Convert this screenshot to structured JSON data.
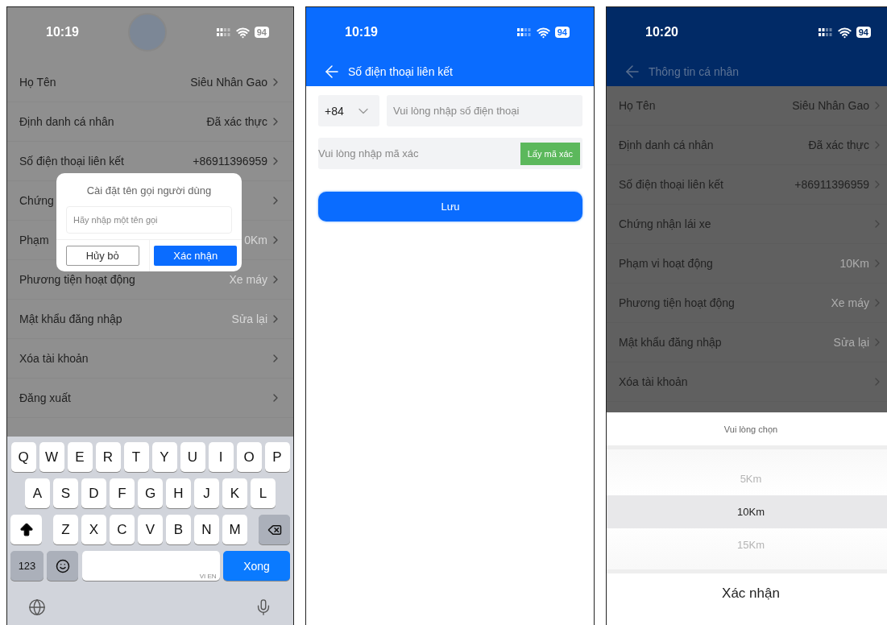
{
  "profile_dialog_screen": {
    "status_bar": {
      "time": "10:19",
      "battery": "94"
    },
    "rows": [
      {
        "label": "Họ Tên",
        "value": "Siêu Nhân Gao",
        "muted": false
      },
      {
        "label": "Định danh cá nhân",
        "value": "Đã xác thực",
        "muted": false
      },
      {
        "label": "Số điện thoại liên kết",
        "value": "+86911396959",
        "muted": false
      },
      {
        "label": "Chứng"
      },
      {
        "label": "Phạm",
        "value": "0Km",
        "muted": true
      },
      {
        "label": "Phương tiện hoạt động",
        "value": "Xe máy",
        "muted": true
      },
      {
        "label": "Mật khẩu đăng nhập",
        "value": "Sửa lại",
        "muted": true
      },
      {
        "label": "Xóa tài khoản"
      },
      {
        "label": "Đăng xuất"
      }
    ],
    "dialog": {
      "title": "Cài đặt tên gọi người dùng",
      "placeholder": "Hãy nhập một tên gọi",
      "buttons": [
        {
          "label": "Hủy bỏ",
          "kind": "outline"
        },
        {
          "label": "Xác nhận",
          "kind": "primary"
        }
      ]
    },
    "keyboard": {
      "rows": [
        [
          "Q",
          "W",
          "E",
          "R",
          "T",
          "Y",
          "U",
          "I",
          "O",
          "P"
        ],
        [
          "A",
          "S",
          "D",
          "F",
          "G",
          "H",
          "J",
          "K",
          "L"
        ],
        [
          "Z",
          "X",
          "C",
          "V",
          "B",
          "N",
          "M"
        ]
      ],
      "number_key": "123",
      "space_hint": "VI EN",
      "return_key": "Xong"
    }
  },
  "phone_link_screen": {
    "status_bar": {
      "time": "10:19",
      "battery": "94"
    },
    "title": "Số điện thoại liên kết",
    "country_code": "+84",
    "phone_placeholder": "Vui lòng nhập số điện thoại",
    "code_placeholder": "Vui lòng nhập mã xác",
    "code_button": "Lấy mã xác",
    "save_button": "Lưu"
  },
  "range_picker_screen": {
    "status_bar": {
      "time": "10:20",
      "battery": "94"
    },
    "title": "Thông tin cá nhân",
    "rows": [
      {
        "label": "Họ Tên",
        "value": "Siêu Nhân Gao",
        "muted": false
      },
      {
        "label": "Định danh cá nhân",
        "value": "Đã xác thực",
        "muted": false
      },
      {
        "label": "Số điện thoại liên kết",
        "value": "+86911396959",
        "muted": false
      },
      {
        "label": "Chứng nhận lái xe"
      },
      {
        "label": "Phạm vi hoạt động",
        "value": "10Km",
        "muted": true
      },
      {
        "label": "Phương tiện hoạt động",
        "value": "Xe máy",
        "muted": true
      },
      {
        "label": "Mật khẩu đăng nhập",
        "value": "Sửa lại",
        "muted": true
      },
      {
        "label": "Xóa tài khoản"
      }
    ],
    "picker": {
      "title": "Vui lòng chọn",
      "options": [
        {
          "label": "5Km",
          "selected": false
        },
        {
          "label": "10Km",
          "selected": true
        },
        {
          "label": "15Km",
          "selected": false
        }
      ],
      "confirm": "Xác nhận"
    }
  }
}
